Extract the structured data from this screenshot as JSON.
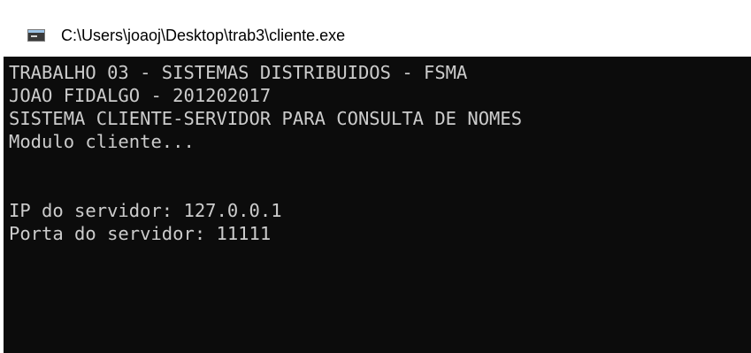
{
  "window": {
    "title": "C:\\Users\\joaoj\\Desktop\\trab3\\cliente.exe",
    "icon": "console-app-icon"
  },
  "console": {
    "lines": [
      "TRABALHO 03 - SISTEMAS DISTRIBUIDOS - FSMA",
      "JOAO FIDALGO - 201202017",
      "SISTEMA CLIENTE-SERVIDOR PARA CONSULTA DE NOMES",
      "Modulo cliente...",
      "",
      "",
      "IP do servidor: 127.0.0.1",
      "Porta do servidor: 11111"
    ],
    "background_color": "#0c0c0c",
    "text_color": "#cccccc"
  }
}
